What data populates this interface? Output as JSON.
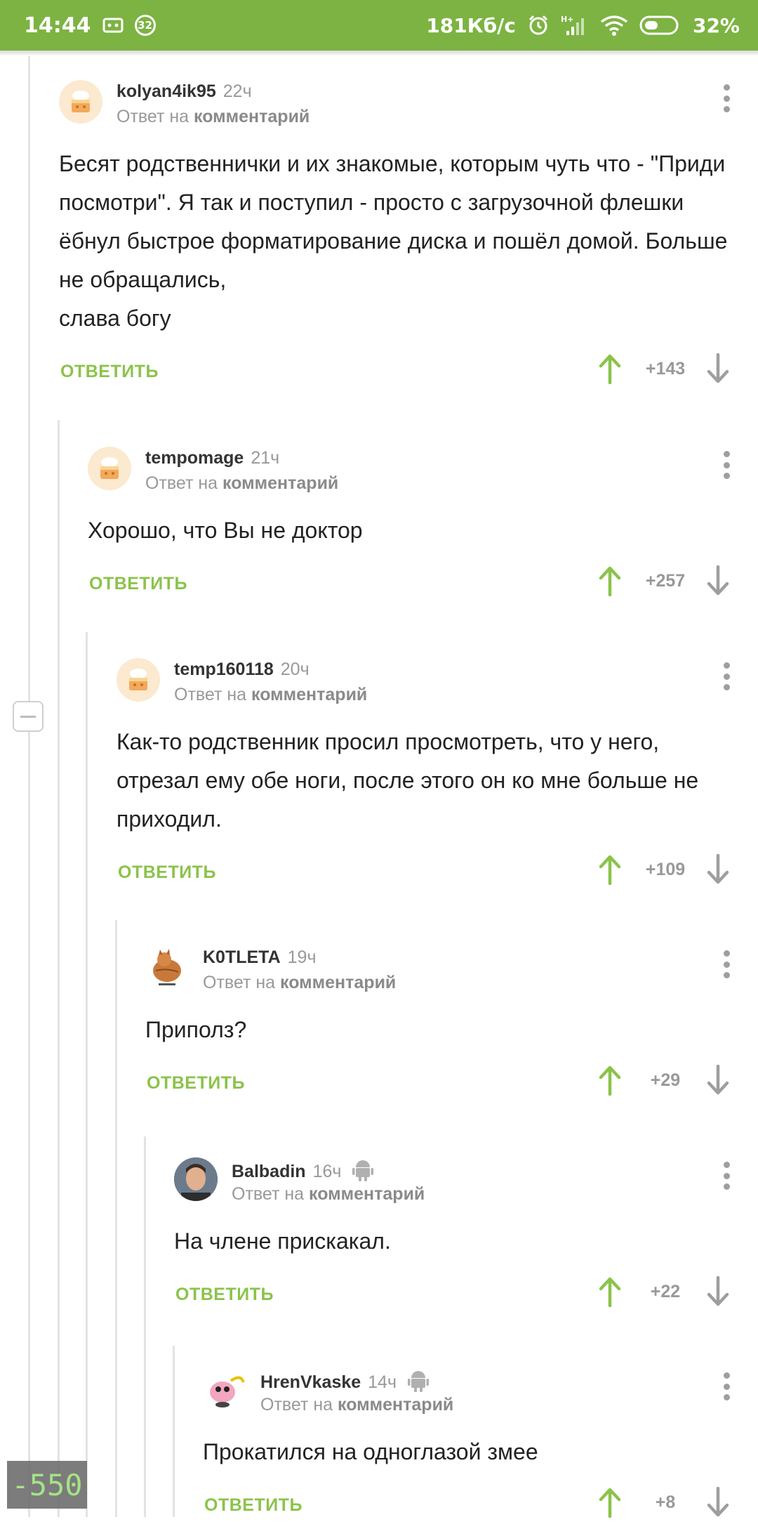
{
  "status_bar": {
    "time": "14:44",
    "notification_count": "32",
    "speed": "181Кб/с",
    "network": "H+",
    "battery": "32%"
  },
  "comments": [
    {
      "author": "kolyan4ik95",
      "time": "22ч",
      "reply_prefix": "Ответ на",
      "reply_target": "комментарий",
      "avatar": "cake-avatar",
      "text": "Бесят родственнички и их знакомые, которым чуть что - \"Приди посмотри\". Я так и поступил - просто с загрузочной флешки ёбнул быстрое форматирование диска и пошёл домой. Больше не обращались,\n слава богу",
      "reply_label": "ОТВЕТИТЬ",
      "score": "+143"
    },
    {
      "author": "tempomage",
      "time": "21ч",
      "reply_prefix": "Ответ на",
      "reply_target": "комментарий",
      "avatar": "cake-avatar",
      "text": "Хорошо, что Вы не доктор",
      "reply_label": "ОТВЕТИТЬ",
      "score": "+257"
    },
    {
      "author": "temp160118",
      "time": "20ч",
      "reply_prefix": "Ответ на",
      "reply_target": "комментарий",
      "avatar": "cake-avatar",
      "text": "Как-то родственник просил просмотреть, что у него, отрезал ему обе ноги, после этого он ко мне больше не приходил.",
      "reply_label": "ОТВЕТИТЬ",
      "score": "+109"
    },
    {
      "author": "K0TLETA",
      "time": "19ч",
      "reply_prefix": "Ответ на",
      "reply_target": "комментарий",
      "avatar": "cat-avatar",
      "text": "Приполз?",
      "reply_label": "ОТВЕТИТЬ",
      "score": "+29"
    },
    {
      "author": "Balbadin",
      "time": "16ч",
      "reply_prefix": "Ответ на",
      "reply_target": "комментарий",
      "avatar": "person-avatar",
      "text": "На члене прискакал.",
      "reply_label": "ОТВЕТИТЬ",
      "score": "+22"
    },
    {
      "author": "HrenVkaske",
      "time": "14ч",
      "reply_prefix": "Ответ на",
      "reply_target": "комментарий",
      "avatar": "pig-avatar",
      "text": "Прокатился на одноглазой змее",
      "reply_label": "ОТВЕТИТЬ",
      "score": "+8"
    }
  ],
  "overlay": {
    "rating": "-550"
  },
  "colors": {
    "accent": "#7cb342",
    "reply": "#8bc34a",
    "muted": "#999999"
  }
}
